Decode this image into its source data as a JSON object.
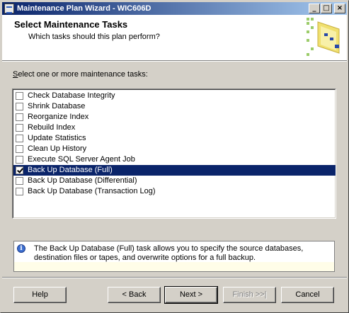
{
  "window": {
    "title": "Maintenance Plan Wizard - WIC606D",
    "minimize": "_",
    "maximize": "□",
    "close": "×"
  },
  "header": {
    "title": "Select Maintenance Tasks",
    "subtitle": "Which tasks should this plan perform?"
  },
  "tasks": {
    "label": "elect one or more maintenance tasks:",
    "label_accel": "S",
    "items": [
      {
        "label": "Check Database Integrity",
        "checked": false
      },
      {
        "label": "Shrink Database",
        "checked": false
      },
      {
        "label": "Reorganize Index",
        "checked": false
      },
      {
        "label": "Rebuild Index",
        "checked": false
      },
      {
        "label": "Update Statistics",
        "checked": false
      },
      {
        "label": "Clean Up History",
        "checked": false
      },
      {
        "label": "Execute SQL Server Agent Job",
        "checked": false
      },
      {
        "label": "Back Up Database (Full)",
        "checked": true,
        "selected": true
      },
      {
        "label": "Back Up Database (Differential)",
        "checked": false
      },
      {
        "label": "Back Up Database (Transaction Log)",
        "checked": false
      }
    ]
  },
  "info": {
    "text": "The Back Up Database (Full) task allows you to specify the source databases, destination files or tapes, and overwrite options for a full backup."
  },
  "buttons": {
    "help": "Help",
    "back": "< Back",
    "next": "Next >",
    "finish": "Finish >>|",
    "cancel": "Cancel"
  },
  "colors": {
    "titlebar_start": "#0a246a",
    "titlebar_end": "#a6caf0",
    "selection": "#0a246a",
    "dialog_face": "#d4d0c8"
  }
}
